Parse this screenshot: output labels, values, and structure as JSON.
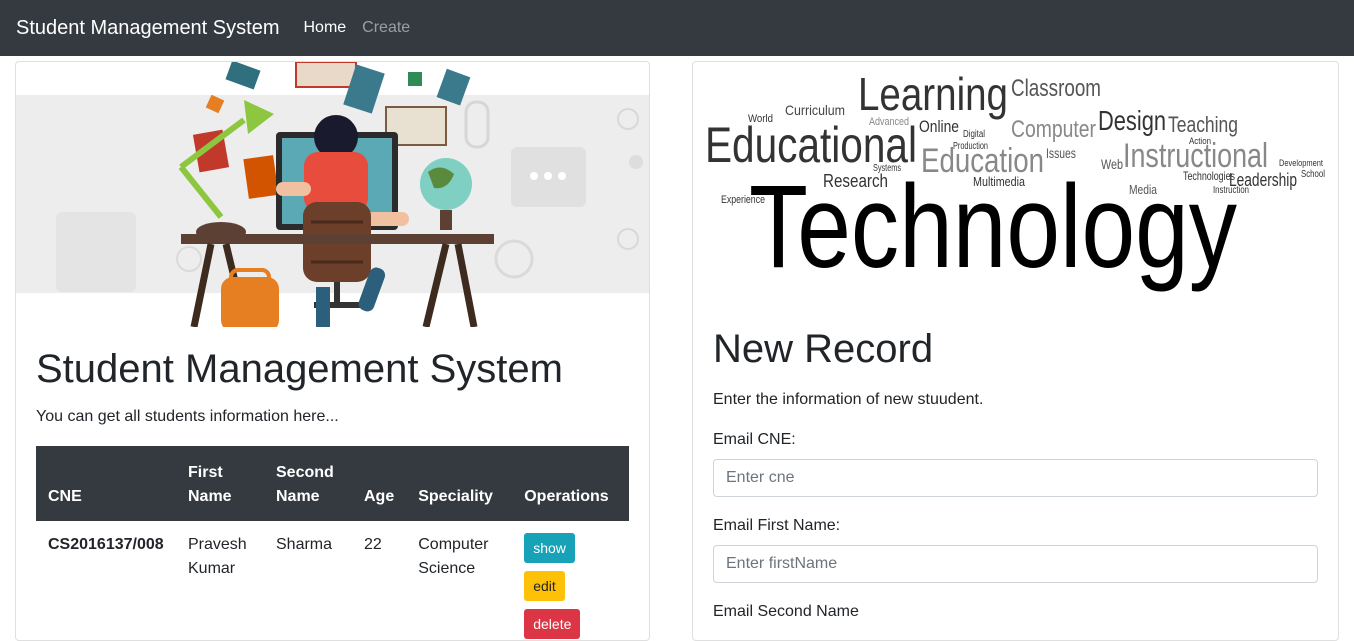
{
  "navbar": {
    "brand": "Student Management System",
    "links": [
      {
        "label": "Home",
        "active": true
      },
      {
        "label": "Create",
        "active": false
      }
    ]
  },
  "left_panel": {
    "title": "Student Management System",
    "subtitle": "You can get all students information here...",
    "table": {
      "headers": [
        "CNE",
        "First Name",
        "Second Name",
        "Age",
        "Speciality",
        "Operations"
      ],
      "rows": [
        {
          "cne": "CS2016137/008",
          "first_name": "Pravesh Kumar",
          "second_name": "Sharma",
          "age": "22",
          "speciality": "Computer Science",
          "operations": [
            "show",
            "edit",
            "delete"
          ]
        }
      ]
    }
  },
  "right_panel": {
    "word_cloud": {
      "headline": "Technology",
      "words": [
        "Learning",
        "Classroom",
        "Curriculum",
        "Educational",
        "Online",
        "Computer",
        "Design",
        "Teaching",
        "Education",
        "Instructional",
        "Research",
        "Multimedia",
        "Leadership",
        "Technologies",
        "Web",
        "Media",
        "Issues",
        "Systems",
        "World",
        "Advanced",
        "Experience",
        "Production",
        "School",
        "Development",
        "Instruction",
        "Digital",
        "Action"
      ]
    },
    "title": "New Record",
    "subtitle": "Enter the information of new stuudent.",
    "form": {
      "fields": [
        {
          "label": "Email CNE:",
          "placeholder": "Enter cne"
        },
        {
          "label": "Email First Name:",
          "placeholder": "Enter firstName"
        },
        {
          "label": "Email Second Name",
          "placeholder": ""
        }
      ]
    }
  },
  "colors": {
    "navbar": "#343a40",
    "show": "#17a2b8",
    "edit": "#ffc107",
    "delete": "#dc3545"
  }
}
